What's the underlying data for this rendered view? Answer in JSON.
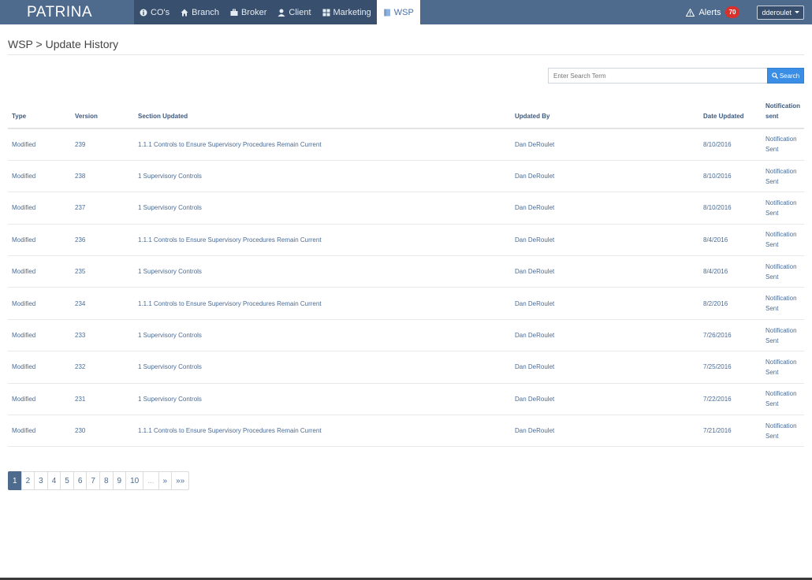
{
  "brand": "PATRINA",
  "nav": [
    {
      "label": "CO's",
      "icon": "info-circle-icon",
      "active": false
    },
    {
      "label": "Branch",
      "icon": "home-icon",
      "active": false
    },
    {
      "label": "Broker",
      "icon": "briefcase-icon",
      "active": false
    },
    {
      "label": "Client",
      "icon": "user-icon",
      "active": false
    },
    {
      "label": "Marketing",
      "icon": "grid-icon",
      "active": false
    },
    {
      "label": "WSP",
      "icon": "book-icon",
      "active": true
    }
  ],
  "alerts": {
    "label": "Alerts",
    "count": "70"
  },
  "user": {
    "name": "dderoulet"
  },
  "page_title": "WSP > Update History",
  "search": {
    "placeholder": "Enter Search Term",
    "button": "Search"
  },
  "table": {
    "headers": {
      "type": "Type",
      "version": "Version",
      "section": "Section Updated",
      "updated_by": "Updated By",
      "date": "Date Updated",
      "notification": "Notification sent"
    },
    "rows": [
      {
        "type": "Modified",
        "version": "239",
        "section": "1.1.1 Controls to Ensure Supervisory Procedures Remain Current",
        "updated_by": "Dan DeRoulet",
        "date": "8/10/2016",
        "notification": "Notification Sent"
      },
      {
        "type": "Modified",
        "version": "238",
        "section": "1 Supervisory Controls",
        "updated_by": "Dan DeRoulet",
        "date": "8/10/2016",
        "notification": "Notification Sent"
      },
      {
        "type": "Modified",
        "version": "237",
        "section": "1 Supervisory Controls",
        "updated_by": "Dan DeRoulet",
        "date": "8/10/2016",
        "notification": "Notification Sent"
      },
      {
        "type": "Modified",
        "version": "236",
        "section": "1.1.1 Controls to Ensure Supervisory Procedures Remain Current",
        "updated_by": "Dan DeRoulet",
        "date": "8/4/2016",
        "notification": "Notification Sent"
      },
      {
        "type": "Modified",
        "version": "235",
        "section": "1 Supervisory Controls",
        "updated_by": "Dan DeRoulet",
        "date": "8/4/2016",
        "notification": "Notification Sent"
      },
      {
        "type": "Modified",
        "version": "234",
        "section": "1.1.1 Controls to Ensure Supervisory Procedures Remain Current",
        "updated_by": "Dan DeRoulet",
        "date": "8/2/2016",
        "notification": "Notification Sent"
      },
      {
        "type": "Modified",
        "version": "233",
        "section": "1 Supervisory Controls",
        "updated_by": "Dan DeRoulet",
        "date": "7/26/2016",
        "notification": "Notification Sent"
      },
      {
        "type": "Modified",
        "version": "232",
        "section": "1 Supervisory Controls",
        "updated_by": "Dan DeRoulet",
        "date": "7/25/2016",
        "notification": "Notification Sent"
      },
      {
        "type": "Modified",
        "version": "231",
        "section": "1 Supervisory Controls",
        "updated_by": "Dan DeRoulet",
        "date": "7/22/2016",
        "notification": "Notification Sent"
      },
      {
        "type": "Modified",
        "version": "230",
        "section": "1.1.1 Controls to Ensure Supervisory Procedures Remain Current",
        "updated_by": "Dan DeRoulet",
        "date": "7/21/2016",
        "notification": "Notification Sent"
      }
    ]
  },
  "pagination": [
    "1",
    "2",
    "3",
    "4",
    "5",
    "6",
    "7",
    "8",
    "9",
    "10",
    "...",
    "»",
    "»»"
  ],
  "pagination_active": "1",
  "colors": {
    "navbar": "#4e6a8c",
    "nav_menu": "#38506e",
    "link": "#4b6c96",
    "search_button": "#3a8ee6",
    "badge": "#d9302c"
  }
}
